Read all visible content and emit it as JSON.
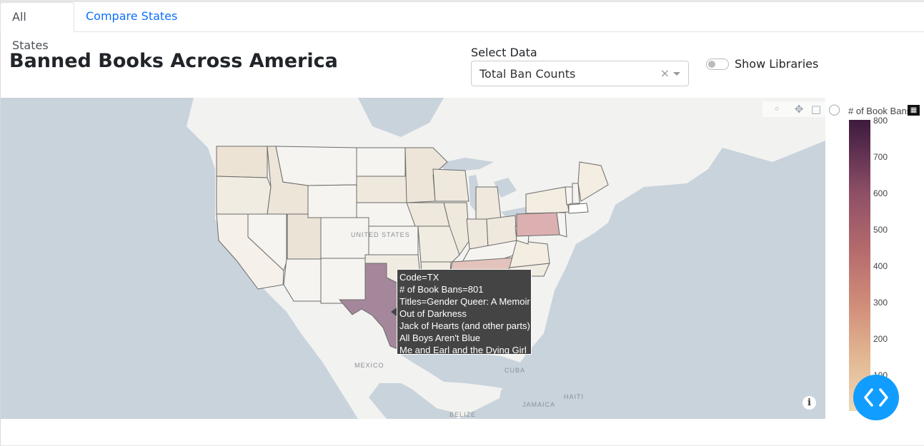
{
  "tabs": [
    {
      "label": "All States",
      "active": true
    },
    {
      "label": "Compare States",
      "active": false
    }
  ],
  "header": {
    "title": "Banned Books Across America"
  },
  "select_data": {
    "label": "Select Data",
    "value": "Total Ban Counts",
    "clear_glyph": "×"
  },
  "toggle": {
    "label": "Show Libraries",
    "on": false
  },
  "map": {
    "labels": {
      "us": "UNITED STATES",
      "mexico": "MEXICO",
      "cuba": "CUBA",
      "haiti": "HAITI",
      "jamaica": "JAMAICA",
      "belize": "BELIZE"
    },
    "modebar_icons": [
      "camera-icon",
      "pan-icon",
      "box-select-icon",
      "lasso-icon"
    ],
    "info_glyph": "i"
  },
  "tooltip": {
    "code": "Code=TX",
    "bans": "# of Book Bans=801",
    "titles": "Titles=Gender Queer: A Memoir",
    "line4": "Out of Darkness",
    "line5": "Jack of Hearts (and other parts)",
    "line6": "All Boys Aren't Blue",
    "line7": "Me and Earl and the Dying Girl"
  },
  "colorbar": {
    "title": "# of Book Bans",
    "ticks": [
      "800",
      "700",
      "600",
      "500",
      "400",
      "300",
      "200",
      "100"
    ],
    "colors": {
      "low": "#edd9b9",
      "high": "#3d1a3c"
    }
  },
  "colors": {
    "tab_link": "#0d6efd",
    "fab": "#119dff",
    "texas": "#a4879a",
    "pennsylvania": "#dcb0b0",
    "tennessee": "#e3c3bc"
  }
}
